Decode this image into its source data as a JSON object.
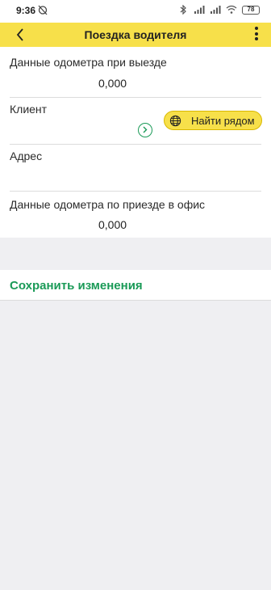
{
  "status_bar": {
    "time": "9:36",
    "battery": "78"
  },
  "header": {
    "title": "Поездка водителя"
  },
  "form": {
    "odometer_departure": {
      "label": "Данные одометра при выезде",
      "value": "0,000"
    },
    "client": {
      "label": "Клиент",
      "find_button_label": "Найти рядом"
    },
    "address": {
      "label": "Адрес"
    },
    "odometer_arrival": {
      "label": "Данные одометра по приезде в офис",
      "value": "0,000"
    }
  },
  "actions": {
    "save_label": "Сохранить изменения"
  },
  "colors": {
    "accent": "#f7e04a",
    "green": "#1a9a57"
  }
}
